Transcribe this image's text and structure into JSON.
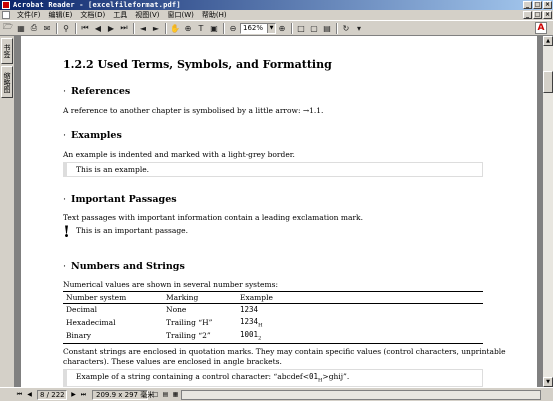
{
  "window": {
    "title": "Acrobat Reader - [excelfileformat.pdf]",
    "controls": [
      "_",
      "□",
      "×"
    ]
  },
  "menubar": {
    "items": [
      "文件(F)",
      "编辑(E)",
      "文档(D)",
      "工具",
      "视图(V)",
      "窗口(W)",
      "帮助(H)"
    ],
    "mdi_controls": [
      "_",
      "□",
      "×"
    ]
  },
  "toolbar": {
    "zoom": "162%",
    "icons": [
      "open-icon",
      "save-icon",
      "print-icon",
      "email-icon",
      "find-icon",
      "first-page-icon",
      "prev-page-icon",
      "next-page-icon",
      "last-page-icon",
      "back-icon",
      "forward-icon",
      "hand-icon",
      "zoom-in-icon",
      "select-text-icon",
      "zoom-out-icon",
      "actual-size-icon",
      "fit-page-icon",
      "fit-width-icon",
      "rotate-icon",
      "acrobat-icon"
    ]
  },
  "left_tabs": [
    "书签",
    "缩略图"
  ],
  "document": {
    "section_title": "1.2.2  Used Terms, Symbols, and Formatting",
    "references": {
      "heading": "References",
      "text": "A reference to another chapter is symbolised by a little arrow: →1.1."
    },
    "examples": {
      "heading": "Examples",
      "text": "An example is indented and marked with a light-grey border.",
      "example": "This is an example."
    },
    "important": {
      "heading": "Important Passages",
      "text": "Text passages with important information contain a leading exclamation mark.",
      "passage": "This is an important passage.",
      "mark": "!"
    },
    "numbers": {
      "heading": "Numbers and Strings",
      "text": "Numerical values are shown in several number systems:",
      "columns": [
        "Number system",
        "Marking",
        "Example"
      ],
      "rows": [
        {
          "system": "Decimal",
          "marking": "None",
          "example": "1234",
          "suffix": ""
        },
        {
          "system": "Hexadecimal",
          "marking": "Trailing “H”",
          "example": "1234",
          "suffix": "H"
        },
        {
          "system": "Binary",
          "marking": "Trailing “2”",
          "example": "1001",
          "suffix": "2"
        }
      ],
      "strings_text_1": "Constant strings are enclosed in quotation marks. They may contain specific values (control characters, unprintable",
      "strings_text_2": "characters). These values are enclosed in angle brackets.",
      "string_example_before": "Example of a string containing a control character: “abcdef<",
      "string_example_code": "01",
      "string_example_sub": "H",
      "string_example_after": ">ghij”."
    }
  },
  "status": {
    "page": "8 / 222",
    "page_size": "209.9 x 297 毫米"
  },
  "colors": {
    "titlebar_start": "#0a246a",
    "titlebar_end": "#a6caf0",
    "chrome": "#d4d0c8",
    "example_border": "#dddddd"
  }
}
